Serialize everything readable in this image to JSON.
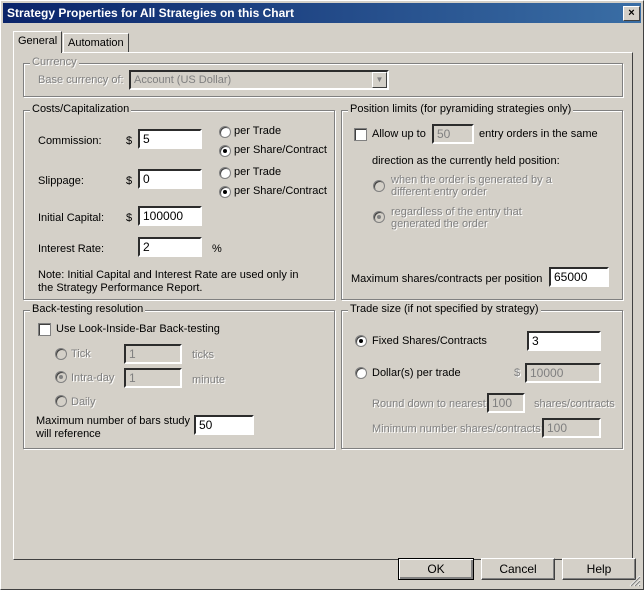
{
  "window": {
    "title": "Strategy Properties for All Strategies on this Chart",
    "close_glyph": "×"
  },
  "tabs": [
    {
      "label": "General",
      "active": true
    },
    {
      "label": "Automation",
      "active": false
    }
  ],
  "currency": {
    "group_label": "Currency",
    "base_label": "Base currency of:",
    "selected": "Account (US Dollar)"
  },
  "costs": {
    "group_label": "Costs/Capitalization",
    "commission_label": "Commission:",
    "commission_currency": "$",
    "commission_value": "5",
    "commission_per_trade": "per Trade",
    "commission_per_share": "per Share/Contract",
    "slippage_label": "Slippage:",
    "slippage_currency": "$",
    "slippage_value": "0",
    "slippage_per_trade": "per Trade",
    "slippage_per_share": "per Share/Contract",
    "initial_capital_label": "Initial Capital:",
    "initial_capital_currency": "$",
    "initial_capital_value": "100000",
    "interest_rate_label": "Interest Rate:",
    "interest_rate_value": "2",
    "interest_rate_unit": "%",
    "note_line1": "Note: Initial Capital and Interest Rate are used only in",
    "note_line2": "the Strategy Performance Report."
  },
  "position_limits": {
    "group_label": "Position limits (for pyramiding strategies only)",
    "allow_up_to": "Allow up to",
    "allow_value": "50",
    "entry_orders": "entry orders in the same",
    "direction_text": "direction as the currently held position:",
    "option1_line1": "when the order is generated by a",
    "option1_line2": "different entry order",
    "option2_line1": "regardless of the entry that",
    "option2_line2": "generated the order",
    "max_shares_label": "Maximum shares/contracts per position",
    "max_shares_value": "65000"
  },
  "backtesting": {
    "group_label": "Back-testing resolution",
    "look_inside_label": "Use Look-Inside-Bar Back-testing",
    "tick_label": "Tick",
    "tick_value": "1",
    "tick_unit": "ticks",
    "intraday_label": "Intra-day",
    "intraday_value": "1",
    "intraday_unit": "minute",
    "daily_label": "Daily",
    "max_bars_line1": "Maximum number of bars study",
    "max_bars_line2": "will reference",
    "max_bars_value": "50"
  },
  "trade_size": {
    "group_label": "Trade size (if not specified by strategy)",
    "fixed_label": "Fixed Shares/Contracts",
    "fixed_value": "3",
    "dollars_label": "Dollar(s) per trade",
    "dollars_currency": "$",
    "dollars_value": "10000",
    "round_down_label": "Round down to nearest",
    "round_down_value": "100",
    "round_down_unit": "shares/contracts",
    "min_shares_label": "Minimum number shares/contracts:",
    "min_shares_value": "100"
  },
  "buttons": {
    "ok": "OK",
    "cancel": "Cancel",
    "help": "Help"
  }
}
